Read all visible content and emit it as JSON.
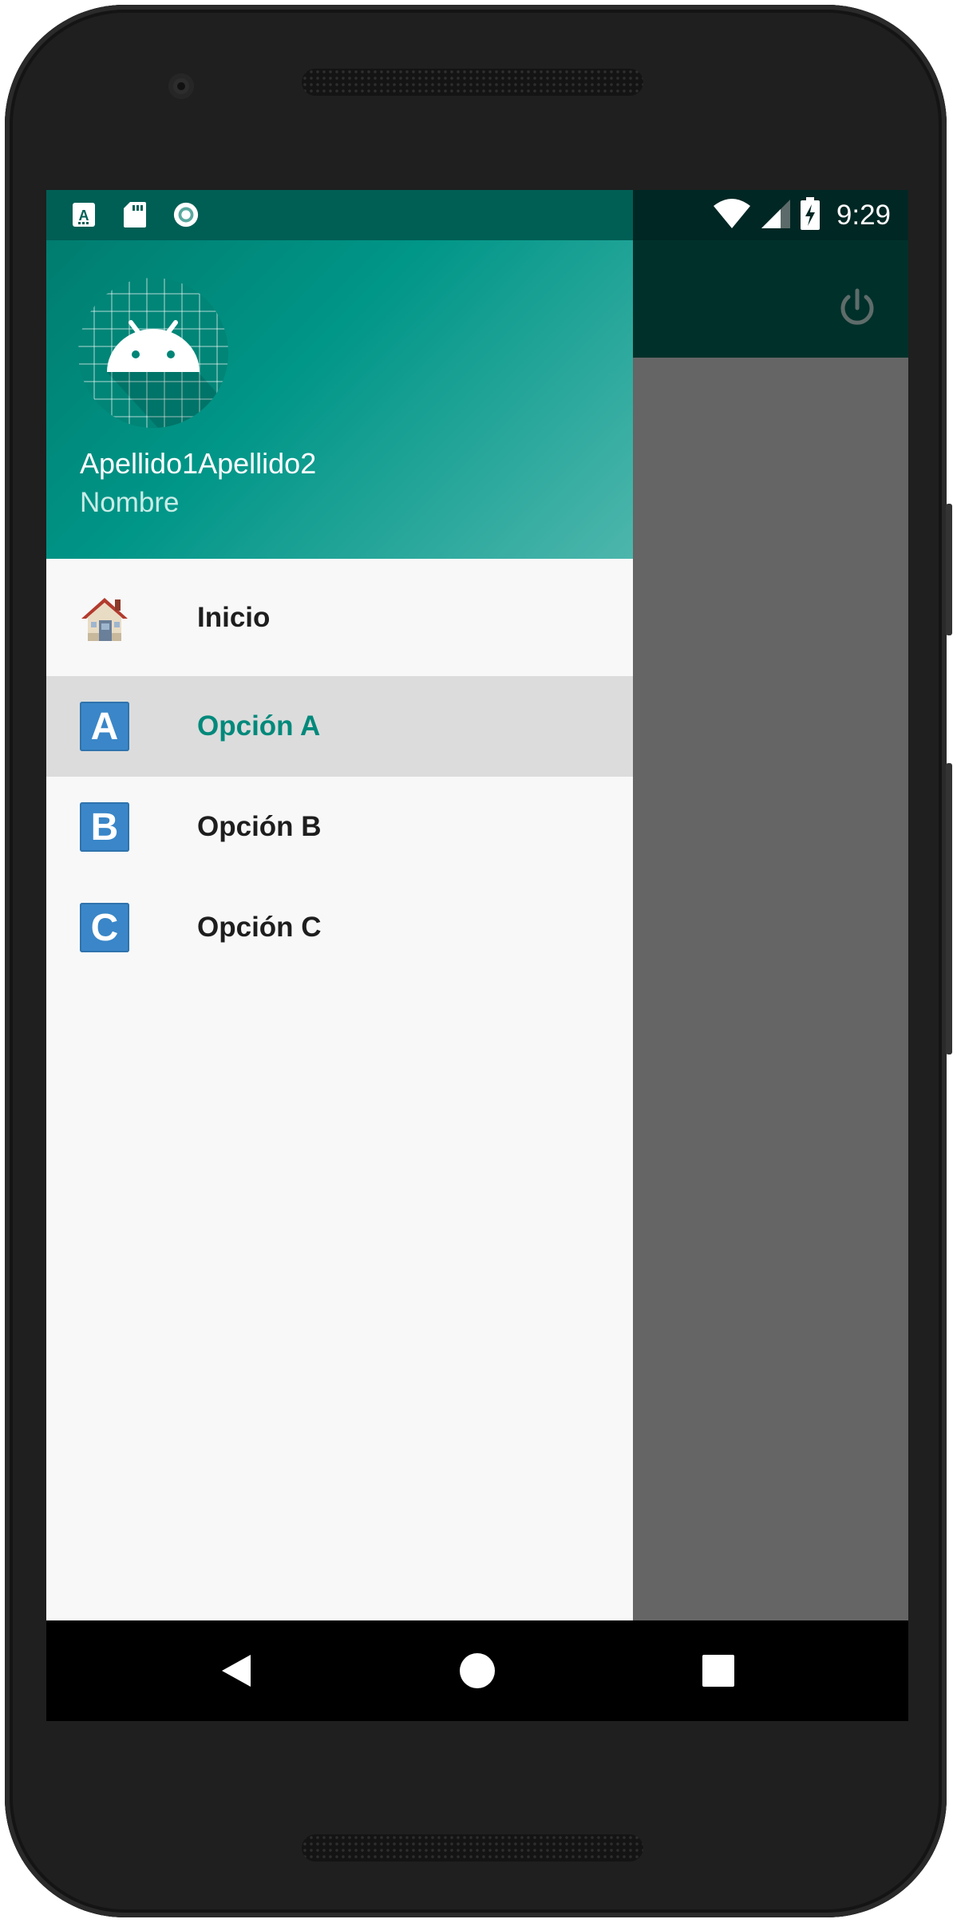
{
  "status_bar": {
    "time": "9:29",
    "left_icons": [
      "a-notification-icon",
      "sd-card-icon",
      "record-icon"
    ],
    "right_icons": [
      "wifi-icon",
      "signal-icon",
      "battery-charging-icon"
    ]
  },
  "toolbar": {
    "action_icon": "power-icon"
  },
  "drawer": {
    "header": {
      "avatar_icon": "android-icon",
      "name": "Apellido1Apellido2",
      "subtitle": "Nombre"
    },
    "items": [
      {
        "label": "Inicio",
        "icon": "house-icon"
      },
      {
        "label": "Opción A",
        "icon": "letter-a-icon",
        "active": true
      },
      {
        "label": "Opción B",
        "icon": "letter-b-icon"
      },
      {
        "label": "Opción C",
        "icon": "letter-c-icon"
      }
    ]
  },
  "nav_bar": {
    "buttons": [
      "back-icon",
      "home-icon",
      "recents-icon"
    ]
  },
  "colors": {
    "accent": "#009688",
    "active_text": "#00897b",
    "status_bar_drawer": "#005f55",
    "scrim": "#656565"
  }
}
